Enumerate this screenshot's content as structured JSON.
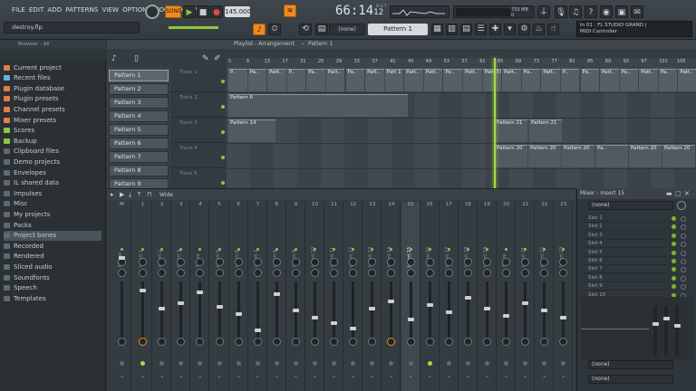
{
  "menu": [
    "FILE",
    "EDIT",
    "ADD",
    "PATTERNS",
    "VIEW",
    "OPTIONS",
    "TOOLS",
    "HELP"
  ],
  "transport": {
    "mode": "SONG",
    "tempo": "145.000",
    "time": "66:14",
    "time_ticks": "12",
    "time_unit": "B:S:T",
    "cpu": "733 MB",
    "cpu_sub": "0"
  },
  "project_file": "destroy.flp",
  "pattern_selector": "Pattern 1",
  "snap": "(none)",
  "hint": {
    "line1": "In 01 : FL STUDIO GRAND |",
    "line2": "MIDI Controller"
  },
  "browser": {
    "title": "Browser - All",
    "items": [
      "Current project",
      "Recent files",
      "Plugin database",
      "Plugin presets",
      "Channel presets",
      "Mixer presets",
      "Scores",
      "Backup",
      "Clipboard files",
      "Demo projects",
      "Envelopes",
      "IL shared data",
      "Impulses",
      "Misc",
      "My projects",
      "Packs",
      "Project bones",
      "Recorded",
      "Rendered",
      "Sliced audio",
      "Soundfonts",
      "Speech",
      "Templates"
    ]
  },
  "playlist": {
    "title": "Playlist - Arrangement",
    "crumb": "Pattern 1",
    "patterns": [
      "Pattern 1",
      "Pattern 2",
      "Pattern 3",
      "Pattern 4",
      "Pattern 5",
      "Pattern 6",
      "Pattern 7",
      "Pattern 8",
      "Pattern 9"
    ],
    "ruler": [
      "5",
      "9",
      "13",
      "17",
      "21",
      "25",
      "29",
      "33",
      "37",
      "41",
      "45",
      "49",
      "53",
      "57",
      "61",
      "65",
      "69",
      "73",
      "77",
      "81",
      "85",
      "89",
      "93",
      "97",
      "101",
      "105"
    ],
    "tracks": [
      "Track 1",
      "Track 2",
      "Track 3",
      "Track 4",
      "Track 5"
    ],
    "clips_track1": [
      "P..",
      "Pa..",
      "Patt..",
      "P..",
      "Pa..",
      "Patt..",
      "Pa..",
      "Patt..",
      "Patt 1",
      "Patt..",
      "Patt..",
      "Pa..",
      "Patt..",
      "Patt 37",
      "Patt..",
      "Pa..",
      "Patt..",
      "P..",
      "Pa..",
      "Patt..",
      "Pa..",
      "Patt..",
      "Pa..",
      "Patt.."
    ],
    "clip_track2": "Pattern 6",
    "clip_track3a": "Pattern 14",
    "clip_track3b": "Pattern 21",
    "clip_track3c": "Pattern 21",
    "clips_track4": [
      "Pattern 20",
      "Pattern 20",
      "Pattern 20",
      "Pa..",
      "Pattern 20",
      "Pattern 20"
    ]
  },
  "mixer": {
    "title": "Wide",
    "strips": [
      {
        "num": "M",
        "name": "Master"
      },
      {
        "num": "1",
        "name": "Insert 1"
      },
      {
        "num": "2",
        "name": "Insert 2"
      },
      {
        "num": "3",
        "name": "Insert 3"
      },
      {
        "num": "4",
        "name": "Snare"
      },
      {
        "num": "5",
        "name": "Insert 5"
      },
      {
        "num": "6",
        "name": "Insert 6"
      },
      {
        "num": "7",
        "name": "Insert 7"
      },
      {
        "num": "8",
        "name": "Insert 8"
      },
      {
        "num": "9",
        "name": "Insert 9"
      },
      {
        "num": "10",
        "name": "Insert 10"
      },
      {
        "num": "11",
        "name": "Insert 11"
      },
      {
        "num": "12",
        "name": "Insert 12"
      },
      {
        "num": "13",
        "name": "Insert 13"
      },
      {
        "num": "14",
        "name": "Insert 14"
      },
      {
        "num": "15",
        "name": "Insert 15"
      },
      {
        "num": "16",
        "name": "Insert 16"
      },
      {
        "num": "17",
        "name": "Insert 17"
      },
      {
        "num": "18",
        "name": "Insert 18"
      },
      {
        "num": "19",
        "name": "Insert 19"
      },
      {
        "num": "20",
        "name": "Snare"
      },
      {
        "num": "21",
        "name": "Insert 21"
      },
      {
        "num": "22",
        "name": "Insert 22"
      },
      {
        "num": "23",
        "name": "Insert 23"
      }
    ]
  },
  "insert_panel": {
    "title": "Mixer - Insert 15",
    "input": "(none)",
    "slots": [
      "Slot 1",
      "Slot 2",
      "Slot 3",
      "Slot 4",
      "Slot 5",
      "Slot 6",
      "Slot 7",
      "Slot 8",
      "Slot 9",
      "Slot 10"
    ],
    "out1": "(none)",
    "out2": "(none)"
  },
  "colors": {
    "accent": "#f08a1c",
    "green": "#8ec63f",
    "playhead": "#a6dd3b"
  }
}
